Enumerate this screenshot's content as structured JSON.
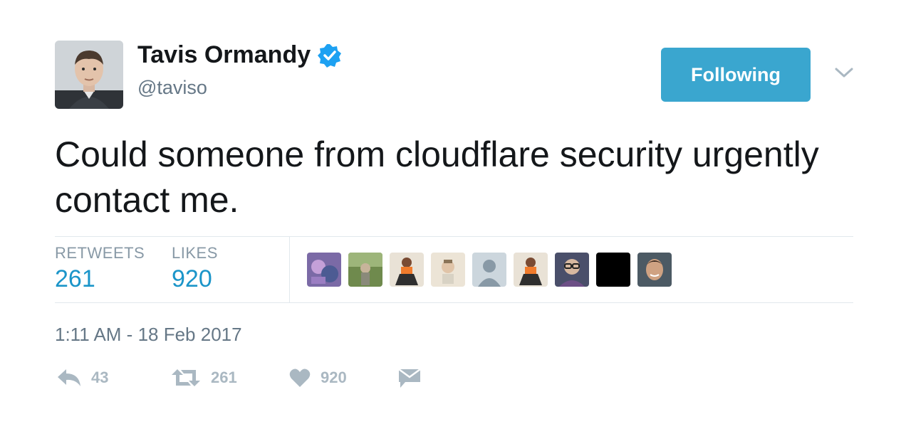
{
  "author": {
    "name": "Tavis Ormandy",
    "handle": "@taviso"
  },
  "follow_button": {
    "label": "Following"
  },
  "tweet": {
    "text": "Could someone from cloudflare security urgently contact me."
  },
  "stats": {
    "retweets_label": "RETWEETS",
    "retweets_value": "261",
    "likes_label": "LIKES",
    "likes_value": "920"
  },
  "likers": [
    "liker-avatar",
    "liker-avatar",
    "liker-avatar",
    "liker-avatar",
    "default-avatar",
    "liker-avatar",
    "liker-avatar",
    "liker-avatar",
    "liker-avatar"
  ],
  "timestamp": "1:11 AM - 18 Feb 2017",
  "actions": {
    "reply_count": "43",
    "retweet_count": "261",
    "like_count": "920"
  },
  "colors": {
    "accent": "#3aa6cf",
    "link": "#1b95c9",
    "muted": "#657786",
    "icon": "#aab8c2"
  },
  "icons": [
    "verified-badge-icon",
    "chevron-down-icon",
    "reply-icon",
    "retweet-icon",
    "heart-icon",
    "message-icon"
  ]
}
